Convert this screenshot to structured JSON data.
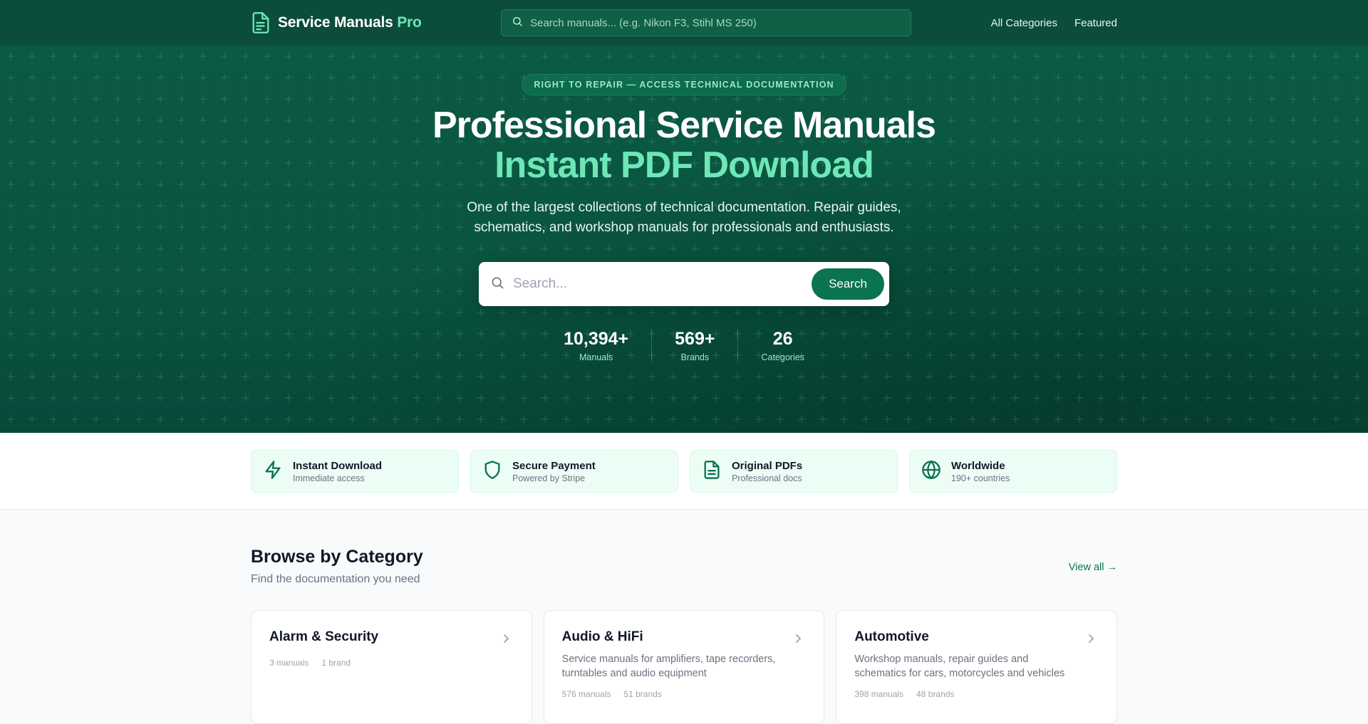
{
  "nav": {
    "brand_main": "Service Manuals",
    "brand_accent": "Pro",
    "search_placeholder": "Search manuals... (e.g. Nikon F3, Stihl MS 250)",
    "links": [
      "All Categories",
      "Featured"
    ]
  },
  "hero": {
    "badge": "RIGHT TO REPAIR — ACCESS TECHNICAL DOCUMENTATION",
    "title": "Professional Service Manuals",
    "title_accent": "Instant PDF Download",
    "subtitle": "One of the largest collections of technical documentation. Repair guides, schematics, and workshop manuals for professionals and enthusiasts.",
    "search_placeholder": "Search...",
    "search_button": "Search",
    "stats": [
      {
        "value": "10,394+",
        "label": "Manuals"
      },
      {
        "value": "569+",
        "label": "Brands"
      },
      {
        "value": "26",
        "label": "Categories"
      }
    ]
  },
  "features": [
    {
      "icon": "lightning-icon",
      "title": "Instant Download",
      "sub": "Immediate access"
    },
    {
      "icon": "shield-icon",
      "title": "Secure Payment",
      "sub": "Powered by Stripe"
    },
    {
      "icon": "document-icon",
      "title": "Original PDFs",
      "sub": "Professional docs"
    },
    {
      "icon": "globe-icon",
      "title": "Worldwide",
      "sub": "190+ countries"
    }
  ],
  "browse": {
    "title": "Browse by Category",
    "subtitle": "Find the documentation you need",
    "view_all": "View all →",
    "cards": [
      {
        "title": "Alarm & Security",
        "desc": "",
        "manuals": "3 manuals",
        "brands": "1 brand"
      },
      {
        "title": "Audio & HiFi",
        "desc": "Service manuals for amplifiers, tape recorders, turntables and audio equipment",
        "manuals": "576 manuals",
        "brands": "51 brands"
      },
      {
        "title": "Automotive",
        "desc": "Workshop manuals, repair guides and schematics for cars, motorcycles and vehicles",
        "manuals": "398 manuals",
        "brands": "48 brands"
      }
    ]
  },
  "colors": {
    "nav_bg": "#0b4d3a",
    "hero_bg": "#0a5440",
    "accent": "#6ee7b7",
    "button": "#0b7351"
  }
}
